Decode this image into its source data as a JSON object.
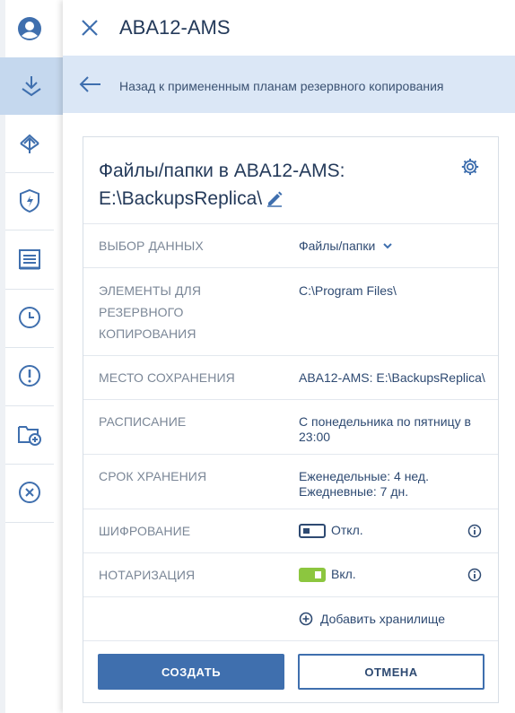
{
  "sidebar": {
    "items": [
      {
        "icon": "user-account-icon"
      },
      {
        "icon": "backup-download-icon",
        "active": true
      },
      {
        "icon": "recovery-upload-icon"
      },
      {
        "icon": "shield-protection-icon"
      },
      {
        "icon": "reports-list-icon"
      },
      {
        "icon": "clock-activities-icon"
      },
      {
        "icon": "alert-icon"
      },
      {
        "icon": "add-folder-icon"
      },
      {
        "icon": "cancel-circle-icon"
      }
    ]
  },
  "panel": {
    "title": "ABA12-AMS",
    "back_label": "Назад к примененным планам резервного копирования"
  },
  "plan": {
    "title_line1": "Файлы/папки в ABA12-AMS:",
    "title_line2": "E:\\BackupsReplica\\",
    "rows": {
      "data_selection": {
        "label": "ВЫБОР ДАННЫХ",
        "value": "Файлы/папки"
      },
      "items": {
        "label_l1": "ЭЛЕМЕНТЫ ДЛЯ",
        "label_l2": "РЕЗЕРВНОГО",
        "label_l3": "КОПИРОВАНИЯ",
        "value": "C:\\Program Files\\"
      },
      "destination": {
        "label": "МЕСТО СОХРАНЕНИЯ",
        "value": "ABA12-AMS: E:\\BackupsReplica\\"
      },
      "schedule": {
        "label": "РАСПИСАНИЕ",
        "value_l1": "С понедельника по пятницу в",
        "value_l2": "23:00"
      },
      "retention": {
        "label": "СРОК ХРАНЕНИЯ",
        "value_l1": "Еженедельные: 4 нед.",
        "value_l2": "Ежедневные: 7 дн."
      },
      "encryption": {
        "label": "ШИФРОВАНИЕ",
        "value": "Откл.",
        "enabled": false
      },
      "notarization": {
        "label": "НОТАРИЗАЦИЯ",
        "value": "Вкл.",
        "enabled": true
      }
    },
    "add_storage_label": "Добавить хранилище",
    "create_label": "СОЗДАТЬ",
    "cancel_label": "ОТМЕНА"
  },
  "colors": {
    "accent": "#3f6fae",
    "active_nav": "#c5d8ee",
    "back_bar": "#dbe7f6",
    "toggle_on": "#8cc63f"
  }
}
